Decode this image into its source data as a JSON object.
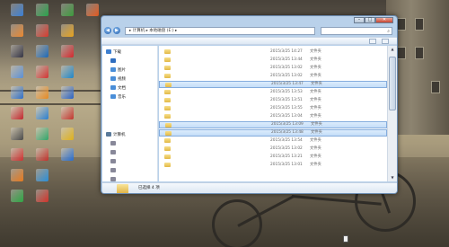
{
  "desktop": {
    "icons": [
      {
        "label": "",
        "color": "#3a7fd5"
      },
      {
        "label": "",
        "color": "#e9872f"
      },
      {
        "label": "",
        "color": "#334"
      },
      {
        "label": "",
        "color": "#5a8fd6"
      },
      {
        "label": "",
        "color": "#2f6fc8"
      },
      {
        "label": "",
        "color": "#c3262d"
      },
      {
        "label": "",
        "color": "#4a4a4a"
      },
      {
        "label": "",
        "color": "#d23232"
      },
      {
        "label": "",
        "color": "#e87a1e"
      },
      {
        "label": "",
        "color": "#2fa845"
      },
      {
        "label": "",
        "color": "#2aa24b"
      },
      {
        "label": "",
        "color": "#d63a2e"
      },
      {
        "label": "",
        "color": "#1b68b8"
      },
      {
        "label": "",
        "color": "#d23333"
      },
      {
        "label": "",
        "color": "#e68a22"
      },
      {
        "label": "",
        "color": "#2a7fd1"
      },
      {
        "label": "",
        "color": "#31a66a"
      },
      {
        "label": "",
        "color": "#c3352e"
      },
      {
        "label": "",
        "color": "#2c8fd8"
      },
      {
        "label": "",
        "color": "#d2352c"
      },
      {
        "label": "",
        "color": "#3c9a3c"
      },
      {
        "label": "",
        "color": "#e6a21d"
      },
      {
        "label": "",
        "color": "#d4272d"
      },
      {
        "label": "",
        "color": "#1e86c9"
      },
      {
        "label": "",
        "color": "#2a62c4"
      },
      {
        "label": "",
        "color": "#c3352e"
      },
      {
        "label": "",
        "color": "#e0b21a"
      },
      {
        "label": "",
        "color": "#2a6fd1"
      },
      {
        "label": "",
        "color": "#e45a20"
      }
    ]
  },
  "window": {
    "address": "▸ 计算机 ▸ 本地磁盘 (E:) ▸",
    "search_placeholder": "",
    "toolbar": {
      "organize": "",
      "include": "",
      "share": "",
      "burn": "",
      "new_folder": ""
    },
    "nav": [
      {
        "label": "下载",
        "icon_color": "#3d7fd0"
      },
      {
        "label": "",
        "icon_color": "#2f6ec0"
      },
      {
        "label": "图片",
        "icon_color": "#4a8ed8"
      },
      {
        "label": "视频",
        "icon_color": "#4a8ed8"
      },
      {
        "label": "文档",
        "icon_color": "#4a8ed8"
      },
      {
        "label": "音乐",
        "icon_color": "#4a8ed8"
      },
      {
        "label": "计算机",
        "icon_color": "#5a7a9a"
      },
      {
        "label": "",
        "icon_color": "#889"
      },
      {
        "label": "",
        "icon_color": "#889"
      },
      {
        "label": "",
        "icon_color": "#889"
      },
      {
        "label": "",
        "icon_color": "#889"
      },
      {
        "label": "",
        "icon_color": "#889"
      },
      {
        "label": "",
        "icon_color": "#889"
      }
    ],
    "files": [
      {
        "name": "",
        "date": "2015/3/25 14:27",
        "type": "文件夹",
        "selected": false
      },
      {
        "name": "",
        "date": "2015/3/25 13:44",
        "type": "文件夹",
        "selected": false
      },
      {
        "name": "",
        "date": "2015/3/25 13:02",
        "type": "文件夹",
        "selected": false
      },
      {
        "name": "",
        "date": "2015/3/25 13:02",
        "type": "文件夹",
        "selected": false
      },
      {
        "name": "",
        "date": "2015/3/25 13:47",
        "type": "文件夹",
        "selected": true
      },
      {
        "name": "",
        "date": "2015/3/25 13:53",
        "type": "文件夹",
        "selected": false
      },
      {
        "name": "",
        "date": "2015/3/25 13:51",
        "type": "文件夹",
        "selected": false
      },
      {
        "name": "",
        "date": "2015/3/25 13:55",
        "type": "文件夹",
        "selected": false
      },
      {
        "name": "",
        "date": "2015/3/25 13:04",
        "type": "文件夹",
        "selected": false
      },
      {
        "name": "",
        "date": "2015/3/25 13:09",
        "type": "文件夹",
        "selected": true
      },
      {
        "name": "",
        "date": "2015/3/25 13:48",
        "type": "文件夹",
        "selected": true
      },
      {
        "name": "",
        "date": "2015/3/25 13:54",
        "type": "文件夹",
        "selected": false
      },
      {
        "name": "",
        "date": "2015/3/25 13:02",
        "type": "文件夹",
        "selected": false
      },
      {
        "name": "",
        "date": "2015/3/25 13:21",
        "type": "文件夹",
        "selected": false
      },
      {
        "name": "",
        "date": "2015/3/25 13:01",
        "type": "文件夹",
        "selected": false
      }
    ],
    "details": {
      "title": "已选择 4 项",
      "subtitle": ""
    },
    "caption": {
      "minimize": "–",
      "maximize": "□",
      "close": "✕"
    },
    "nav_back": "◀",
    "nav_forward": "▶",
    "search_icon": "⌕"
  }
}
